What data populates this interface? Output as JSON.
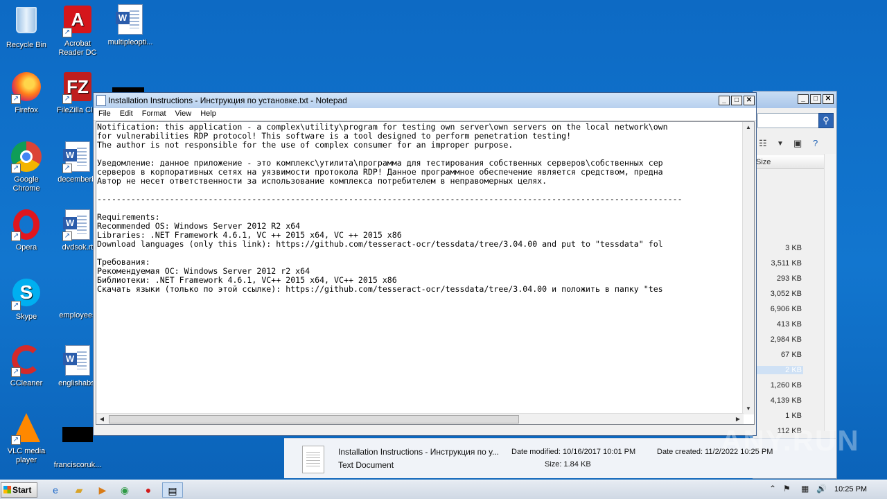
{
  "desktop": {
    "icons": [
      {
        "label": "Recycle Bin",
        "icon": "recycle-bin-icon"
      },
      {
        "label": "Acrobat Reader DC",
        "icon": "acrobat-icon"
      },
      {
        "label": "multipleopti...",
        "icon": "word-doc-icon"
      },
      {
        "label": "Firefox",
        "icon": "firefox-icon"
      },
      {
        "label": "FileZilla Clie",
        "icon": "filezilla-icon"
      },
      {
        "label": "Google Chrome",
        "icon": "chrome-icon"
      },
      {
        "label": "decemberbi",
        "icon": "word-doc-icon"
      },
      {
        "label": "Opera",
        "icon": "opera-icon"
      },
      {
        "label": "dvdsok.rt",
        "icon": "word-doc-icon"
      },
      {
        "label": "Skype",
        "icon": "skype-icon"
      },
      {
        "label": "employees",
        "icon": "file-icon"
      },
      {
        "label": "CCleaner",
        "icon": "ccleaner-icon"
      },
      {
        "label": "englishabst",
        "icon": "word-doc-icon"
      },
      {
        "label": "VLC media player",
        "icon": "vlc-icon"
      },
      {
        "label": "franciscoruk...",
        "icon": "file-icon"
      }
    ]
  },
  "notepad": {
    "title": "Installation Instructions - Инструкция по установке.txt - Notepad",
    "menu": [
      "File",
      "Edit",
      "Format",
      "View",
      "Help"
    ],
    "content": "Notification: this application - a complex\\utility\\program for testing own server\\own servers on the local network\\own\nfor vulnerabilities RDP protocol! This software is a tool designed to perform penetration testing!\nThe author is not responsible for the use of complex consumer for an improper purpose.\n\nУведомление: данное приложение - это комплекс\\утилита\\программа для тестирования собственных серверов\\собственных сер\nсерверов в корпоративных сетях на уязвимости протокола RDP! Данное программное обеспечение является средством, предна\nАвтор не несет ответственности за использование комплекса потребителем в неправомерных целях.\n\n-------------------------------------------------------------------------------------------------------------------------\n\nRequirements:\nRecommended OS: Windows Server 2012 R2 x64\nLibraries: .NET Framework 4.6.1, VC ++ 2015 x64, VC ++ 2015 x86\nDownload languages (only this link): https://github.com/tesseract-ocr/tessdata/tree/3.04.00 and put to \"tessdata\" fol\n\nТребования:\nРекомендуемая ОС: Windows Server 2012 r2 x64\nБиблиотеки: .NET Framework 4.6.1, VC++ 2015 x64, VC++ 2015 x86\nСкачать языки (только по этой ссылке): https://github.com/tesseract-ocr/tessdata/tree/3.04.00 и положить в папку \"tes"
  },
  "explorer": {
    "column_header": "Size",
    "sizes": [
      "3 KB",
      "3,511 KB",
      "293 KB",
      "3,052 KB",
      "6,906 KB",
      "413 KB",
      "2,984 KB",
      "67 KB",
      "2 KB",
      "1,260 KB",
      "4,139 KB",
      "1 KB",
      "112 KB"
    ],
    "selected_index": 8,
    "details": {
      "name": "Installation Instructions - Инструкция по у...",
      "type": "Text Document",
      "date_modified": "Date modified: 10/16/2017 10:01 PM",
      "size": "Size: 1.84 KB",
      "date_created": "Date created: 11/2/2022 10:25 PM"
    }
  },
  "taskbar": {
    "start_label": "Start",
    "clock": "10:25 PM"
  },
  "watermark": "ANY.RUN"
}
